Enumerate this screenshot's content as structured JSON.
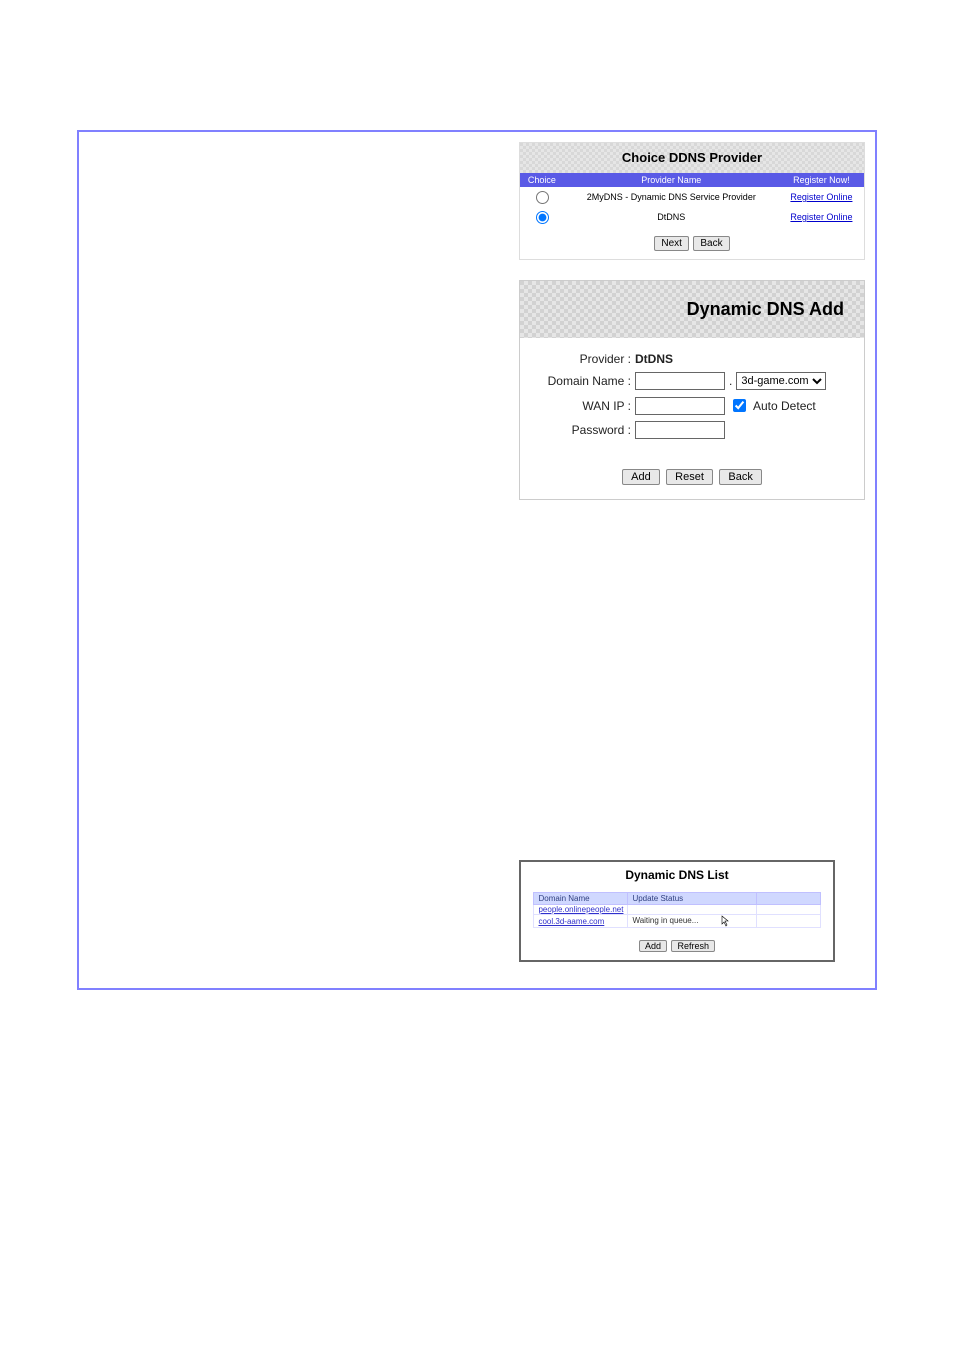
{
  "panel1": {
    "title": "Choice DDNS Provider",
    "cols": {
      "choice": "Choice",
      "provider": "Provider Name",
      "register": "Register Now!"
    },
    "rows": [
      {
        "provider": "2MyDNS - Dynamic DNS Service Provider",
        "link": "Register Online",
        "checked": false
      },
      {
        "provider": "DtDNS",
        "link": "Register Online",
        "checked": true
      }
    ],
    "next": "Next",
    "back": "Back"
  },
  "panel2": {
    "title": "Dynamic DNS Add",
    "labels": {
      "provider": "Provider :",
      "domain": "Domain Name :",
      "wanip": "WAN IP :",
      "password": "Password :"
    },
    "provider_value": "DtDNS",
    "domain_sep": ".",
    "domain_suffix": "3d-game.com",
    "auto_detect": "Auto Detect",
    "add": "Add",
    "reset": "Reset",
    "back": "Back"
  },
  "panel3": {
    "title": "Dynamic DNS List",
    "cols": {
      "domain": "Domain Name",
      "status": "Update Status",
      "blank": ""
    },
    "rows": [
      {
        "domain": "people.onlinepeople.net",
        "status": ""
      },
      {
        "domain": "cool.3d-aame.com",
        "status": "Waiting in queue..."
      }
    ],
    "add": "Add",
    "refresh": "Refresh"
  }
}
